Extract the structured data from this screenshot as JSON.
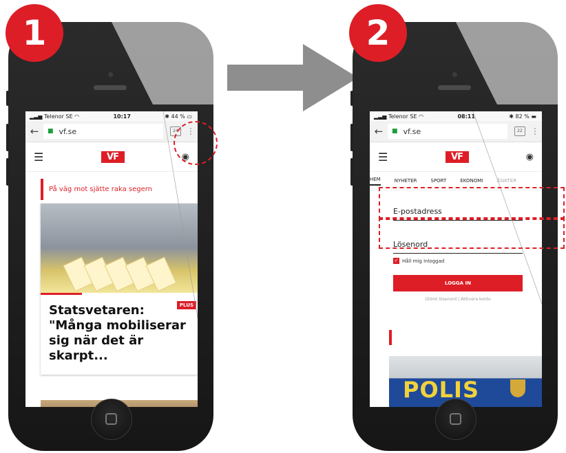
{
  "steps": [
    {
      "number": "1"
    },
    {
      "number": "2"
    }
  ],
  "phone1": {
    "status": {
      "carrier": "Telenor SE",
      "time": "10:17",
      "battery": "44 %"
    },
    "browser": {
      "url": "vf.se",
      "tab_count": "24"
    },
    "site": {
      "logo": "VF"
    },
    "teaser": "På väg mot sjätte raka segern",
    "article": {
      "badge": "PLUS",
      "headline": "Statsvetaren: \"Många mobiliserar sig när det är skarpt..."
    }
  },
  "phone2": {
    "status": {
      "carrier": "Telenor SE",
      "time": "08:11",
      "battery": "82 %"
    },
    "browser": {
      "url": "vf.se",
      "tab_count": "22"
    },
    "site": {
      "logo": "VF"
    },
    "nav_tabs": [
      "HEM",
      "NYHETER",
      "SPORT",
      "EKONOMI",
      "ÅSIKTER"
    ],
    "login": {
      "email_label": "E-postadress",
      "password_label": "Lösenord",
      "remember_label": "Håll mig inloggad",
      "submit_label": "LOGGA IN",
      "forgot_link": "Glömt lösenord",
      "separator": "|",
      "activate_link": "Aktivera konto"
    },
    "photo_text": "POLIS"
  },
  "icons": {
    "back": "back-arrow-icon",
    "lock": "lock-icon",
    "menu": "hamburger-menu-icon",
    "user": "user-account-icon",
    "overflow": "overflow-menu-icon"
  },
  "colors": {
    "accent": "#dd1e26",
    "arrow": "#8e8e8e",
    "phone_body": "#1c1c1c"
  }
}
